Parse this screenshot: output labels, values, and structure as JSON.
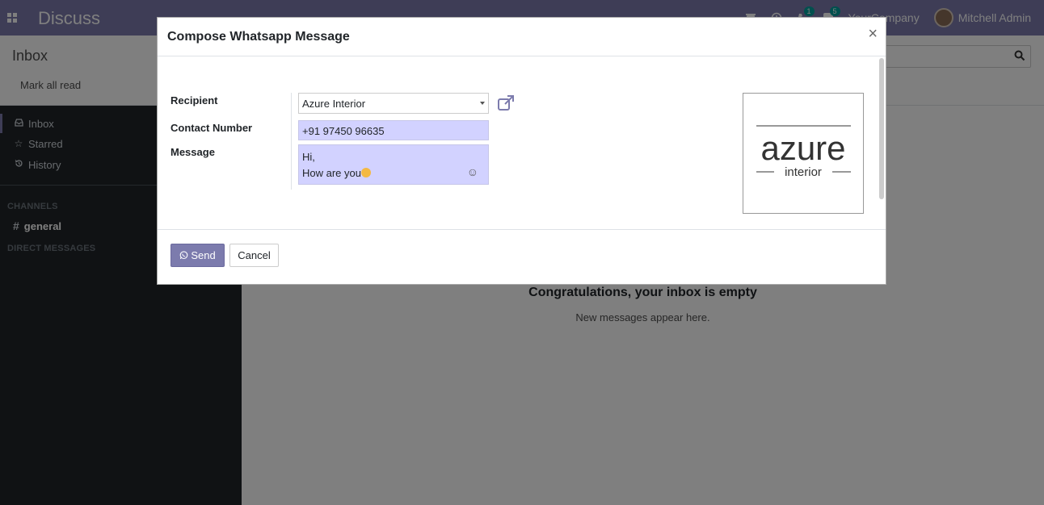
{
  "navbar": {
    "app_title": "Discuss",
    "activity_badge": "1",
    "messages_badge": "5",
    "company": "YourCompany",
    "user_name": "Mitchell Admin"
  },
  "control_panel": {
    "breadcrumb": "Inbox",
    "mark_all_read": "Mark all read"
  },
  "sidebar": {
    "items": [
      {
        "label": "Inbox",
        "icon": "inbox-icon"
      },
      {
        "label": "Starred",
        "icon": "star-icon"
      },
      {
        "label": "History",
        "icon": "history-icon"
      }
    ],
    "channels_header": "CHANNELS",
    "channel_general": "general",
    "direct_messages_header": "DIRECT MESSAGES"
  },
  "main": {
    "empty_title": "Congratulations, your inbox is empty",
    "empty_subtitle": "New messages appear here."
  },
  "modal": {
    "title": "Compose Whatsapp Message",
    "close_symbol": "×",
    "recipient_label": "Recipient",
    "recipient_value": "Azure Interior",
    "contact_label": "Contact Number",
    "contact_value": "+91 97450 96635",
    "message_label": "Message",
    "message_line1": "Hi,",
    "message_line2": "How are you",
    "logo_brand": "azure",
    "logo_sub": "interior",
    "send_label": "Send",
    "cancel_label": "Cancel"
  },
  "colors": {
    "brand": "#7c7bad",
    "sidebar_bg": "#212529",
    "field_bg": "#d2d2ff",
    "badge": "#00a09d"
  }
}
